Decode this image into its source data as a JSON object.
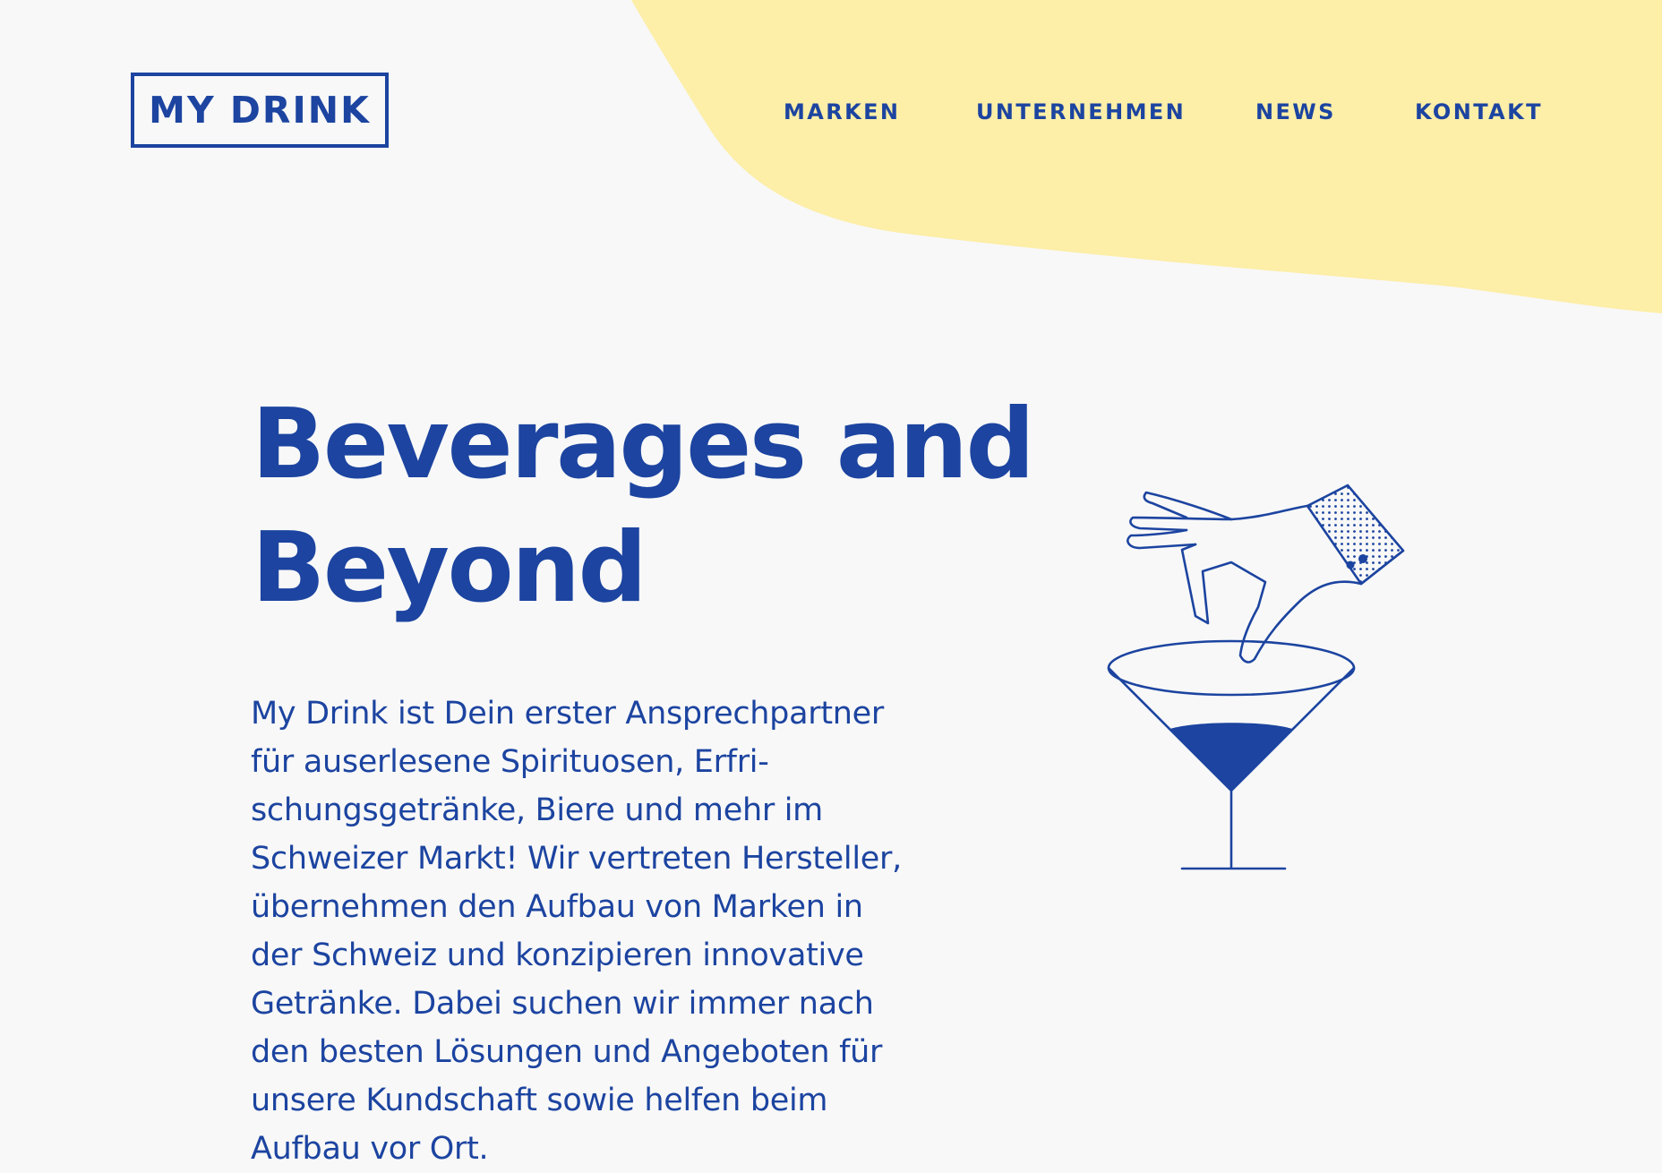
{
  "colors": {
    "brand_blue": "#1c44a0",
    "blob_yellow": "#fdeea8",
    "background": "#f8f8f8"
  },
  "header": {
    "logo_text": "MY DRINK",
    "nav": [
      {
        "label": "MARKEN"
      },
      {
        "label": "UNTERNEHMEN"
      },
      {
        "label": "NEWS"
      },
      {
        "label": "KONTAKT"
      }
    ]
  },
  "hero": {
    "title_lines": [
      "Beverages and",
      "Beyond"
    ],
    "body_lines": [
      "My Drink ist Dein erster Ansprechpartner",
      "für auserlesene Spirituosen, Erfri-",
      "schungsgetränke, Biere und mehr im",
      "Schweizer Markt! Wir vertreten Hersteller,",
      "übernehmen den Aufbau von Marken in",
      "der Schweiz und konzipieren innovative",
      "Getränke. Dabei suchen wir immer nach",
      "den besten Lösungen und Angeboten für",
      "unsere Kundschaft sowie helfen beim",
      "Aufbau vor Ort."
    ]
  },
  "illustration": {
    "icon": "hand-cocktail-glass-icon"
  }
}
